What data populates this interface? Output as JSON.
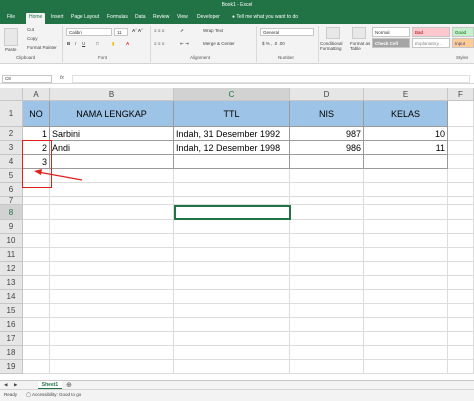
{
  "window": {
    "title": "Book1 - Excel"
  },
  "ribbon_tabs": [
    "File",
    "Home",
    "Insert",
    "Page Layout",
    "Formulas",
    "Data",
    "Review",
    "View",
    "Developer"
  ],
  "tell_me": "Tell me what you want to do",
  "ribbon": {
    "paste": "Paste",
    "cut": "Cut",
    "copy": "Copy",
    "format_painter": "Format Painter",
    "font_name": "Calibri",
    "font_size": "11",
    "wrap_text": "Wrap Text",
    "merge_center": "Merge & Center",
    "number_format": "General",
    "conditional_formatting": "Conditional Formatting",
    "format_as_table": "Format as Table",
    "styles": {
      "normal": "Normal",
      "bad": "Bad",
      "good": "Good",
      "neutral": "Neutral",
      "check_cell": "Check Cell",
      "explanatory": "Explanatory...",
      "input": "Input"
    },
    "groups": {
      "clipboard": "Clipboard",
      "font": "Font",
      "alignment": "Alignment",
      "number": "Number",
      "styles": "Styles"
    }
  },
  "formula_bar": {
    "name_box": "C8",
    "fx": "fx",
    "value": ""
  },
  "columns": [
    "A",
    "B",
    "C",
    "D",
    "E",
    "F"
  ],
  "rows": [
    "1",
    "2",
    "3",
    "4",
    "5",
    "6",
    "7",
    "8",
    "9",
    "10",
    "11",
    "12",
    "13",
    "14",
    "15",
    "16",
    "17",
    "18",
    "19"
  ],
  "table": {
    "headers": [
      "NO",
      "NAMA LENGKAP",
      "TTL",
      "NIS",
      "KELAS"
    ],
    "data": [
      [
        "1",
        "Sarbini",
        "Indah, 31 Desember 1992",
        "987",
        "10"
      ],
      [
        "2",
        "Andi",
        "Indah, 12 Desember 1998",
        "986",
        "11"
      ],
      [
        "3",
        "",
        "",
        "",
        ""
      ]
    ]
  },
  "sheet_tab": "Sheet1",
  "status": {
    "ready": "Ready",
    "accessibility": "Accessibility: Good to go"
  },
  "colors": {
    "excel_green": "#217346",
    "header_fill": "#9dc3e6",
    "annotation_red": "#e0201b"
  }
}
